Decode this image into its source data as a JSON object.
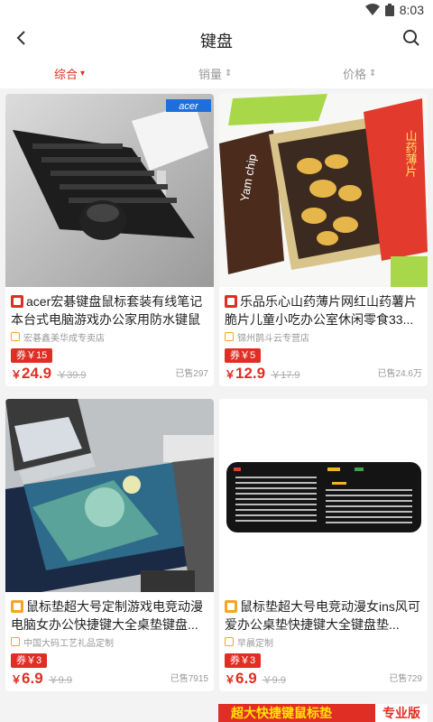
{
  "status": {
    "time": "8:03"
  },
  "header": {
    "title": "键盘"
  },
  "sort": [
    {
      "label": "综合",
      "active": true
    },
    {
      "label": "销量",
      "active": false
    },
    {
      "label": "价格",
      "active": false
    }
  ],
  "products": [
    {
      "title": "acer宏碁键盘鼠标套装有线笔记本台式电脑游戏办公家用防水键鼠",
      "shop": "宏碁鑫美华成专卖店",
      "coupon": "券￥15",
      "currency": "￥",
      "price": "24.9",
      "orig_price": "￥39.9",
      "sold": "已售297",
      "brand_label": "acer"
    },
    {
      "title": "乐品乐心山药薄片网红山药薯片脆片儿童小吃办公室休闲零食33...",
      "shop": "锦州鹊斗云专营店",
      "coupon": "券￥5",
      "currency": "￥",
      "price": "12.9",
      "orig_price": "￥17.9",
      "sold": "已售24.6万",
      "pack_text_left": "Yam chip",
      "pack_text_right": "山药薄片"
    },
    {
      "title": "鼠标垫超大号定制游戏电竞动漫电脑女办公快捷键大全桌垫键盘...",
      "shop": "中国大码工艺礼品定制",
      "coupon": "券￥3",
      "currency": "￥",
      "price": "6.9",
      "orig_price": "￥9.9",
      "sold": "已售7915"
    },
    {
      "title": "鼠标垫超大号电竞动漫女ins风可爱办公桌垫快捷键大全键盘垫...",
      "shop": "早晨定制",
      "coupon": "券￥3",
      "currency": "￥",
      "price": "6.9",
      "orig_price": "￥9.9",
      "sold": "已售729"
    }
  ],
  "peek": {
    "text": "超大快捷键鼠标垫",
    "tag": "专业版"
  },
  "colors": {
    "accent": "#e02e24",
    "muted": "#999999"
  },
  "icons": {
    "back": "back-arrow-icon",
    "search": "search-icon",
    "wifi": "wifi-icon",
    "battery": "battery-icon",
    "chevron": "chevron-down-icon",
    "sort": "sort-updown-icon"
  }
}
